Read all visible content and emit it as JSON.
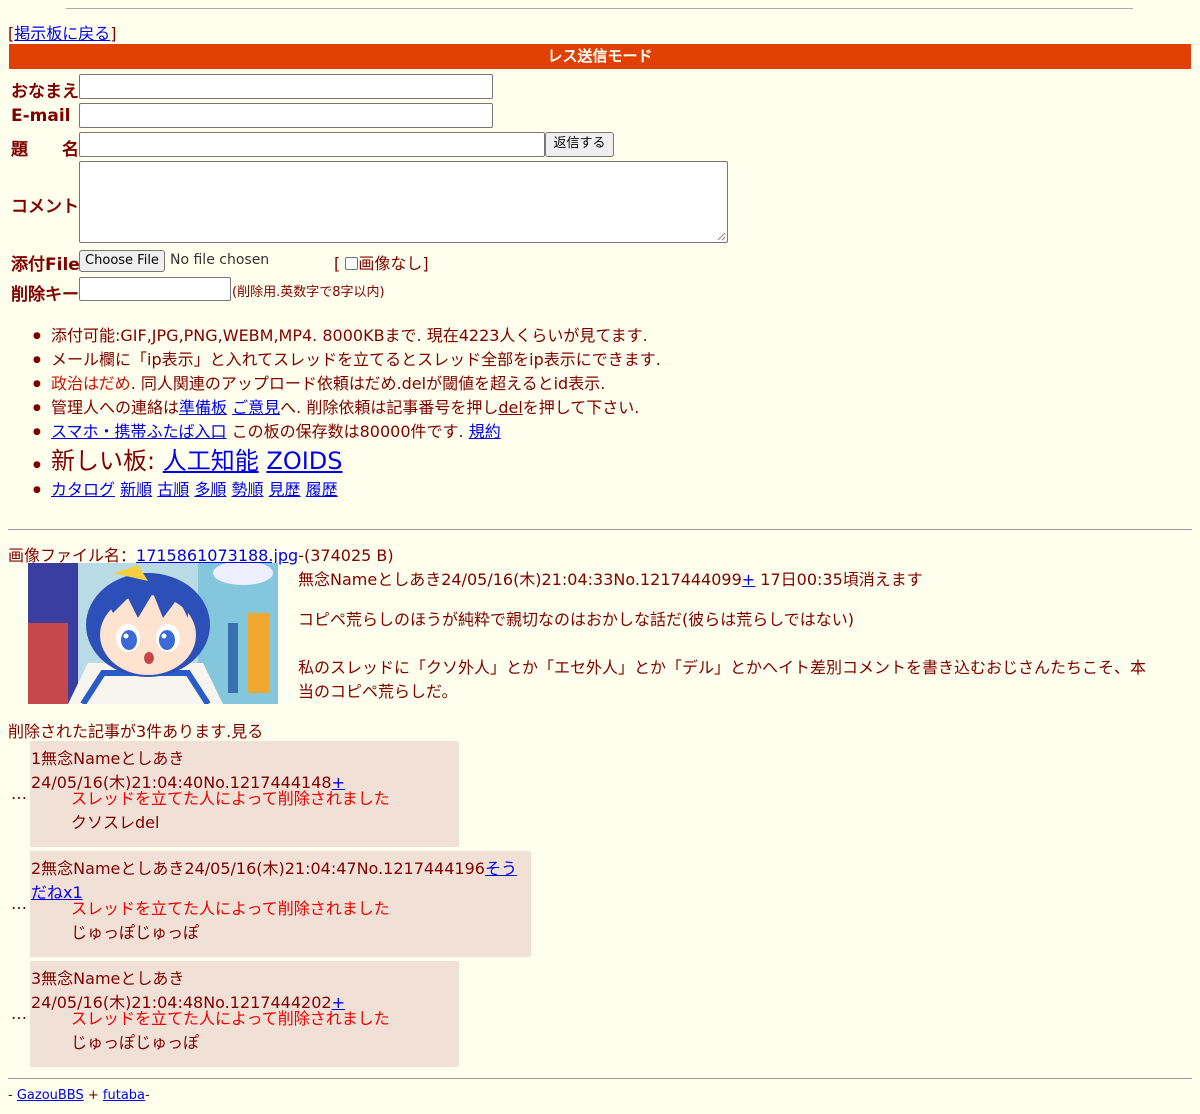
{
  "nav": {
    "back_prefix": "[",
    "back_link": "掲示板に戻る",
    "back_suffix": "]"
  },
  "form": {
    "mode_title": "レス送信モード",
    "name_label": "おなまえ",
    "email_label": "E-mail",
    "subject_label": "題　　名",
    "submit_label": "返信する",
    "comment_label": "コメント",
    "file_label": "添付File",
    "choose_file": "Choose File",
    "no_file": "No file chosen",
    "noimage_prefix": "[",
    "noimage_label": "画像なし",
    "noimage_suffix": "]",
    "delkey_label": "削除キー",
    "delkey_hint": "(削除用.英数字で8字以内)"
  },
  "rules": {
    "r1": "添付可能:GIF,JPG,PNG,WEBM,MP4. 8000KBまで. 現在4223人くらいが見てます.",
    "r2": "メール欄に「ip表示」と入れてスレッドを立てるとスレッド全部をip表示にできます.",
    "r3_red": "政治はだめ",
    "r3_rest": ". 同人関連のアップロード依頼はだめ.delが閾値を超えるとid表示.",
    "r4_a": "管理人への連絡は",
    "r4_link1": "準備板",
    "r4_link2": "ご意見",
    "r4_b": "へ. 削除依頼は記事番号を押し",
    "r4_link3": "del",
    "r4_c": "を押して下さい.",
    "r5_link": "スマホ・携帯ふたば入口",
    "r5_text": "この板の保存数は80000件です.",
    "r5_link2": "規約",
    "r6_text": "新しい板:",
    "r6_link1": "人工知能",
    "r6_link2": "ZOIDS",
    "r7_links": [
      "カタログ",
      "新順",
      "古順",
      "多順",
      "勢順",
      "見歴",
      "履歴"
    ]
  },
  "thread": {
    "file_prefix": "画像ファイル名：",
    "file_name": "1715861073188.jpg",
    "file_size": "-(374025 B)",
    "op_header": "無念Nameとしあき24/05/16(木)21:04:33No.1217444099",
    "op_plus": "+",
    "op_expire": "17日00:35頃消えます",
    "op_line1": "コピペ荒らしのほうが純粋で親切なのはおかしな話だ(彼らは荒らしではない)",
    "op_line2": "私のスレッドに「クソ外人」とか「エセ外人」とか「デル」とかヘイト差別コメントを書き込むおじさんたちこそ、本",
    "op_line3": "当のコピペ荒らしだ。",
    "deleted_notice": "削除された記事が3件あります.見る"
  },
  "replies": [
    {
      "dots": "…",
      "header": "1無念Nameとしあき24/05/16(木)21:04:40No.1217444148",
      "link": "+",
      "deleted": "スレッドを立てた人によって削除されました",
      "body": "クソスレdel"
    },
    {
      "dots": "…",
      "header": "2無念Nameとしあき24/05/16(木)21:04:47No.1217444196",
      "link": "そうだねx1",
      "deleted": "スレッドを立てた人によって削除されました",
      "body": "じゅっぽじゅっぽ"
    },
    {
      "dots": "…",
      "header": "3無念Nameとしあき24/05/16(木)21:04:48No.1217444202",
      "link": "+",
      "deleted": "スレッドを立てた人によって削除されました",
      "body": "じゅっぽじゅっぽ"
    }
  ],
  "footer": {
    "prefix": "- ",
    "link1": "GazouBBS",
    "plus": " + ",
    "link2": "futaba",
    "suffix": "-"
  }
}
